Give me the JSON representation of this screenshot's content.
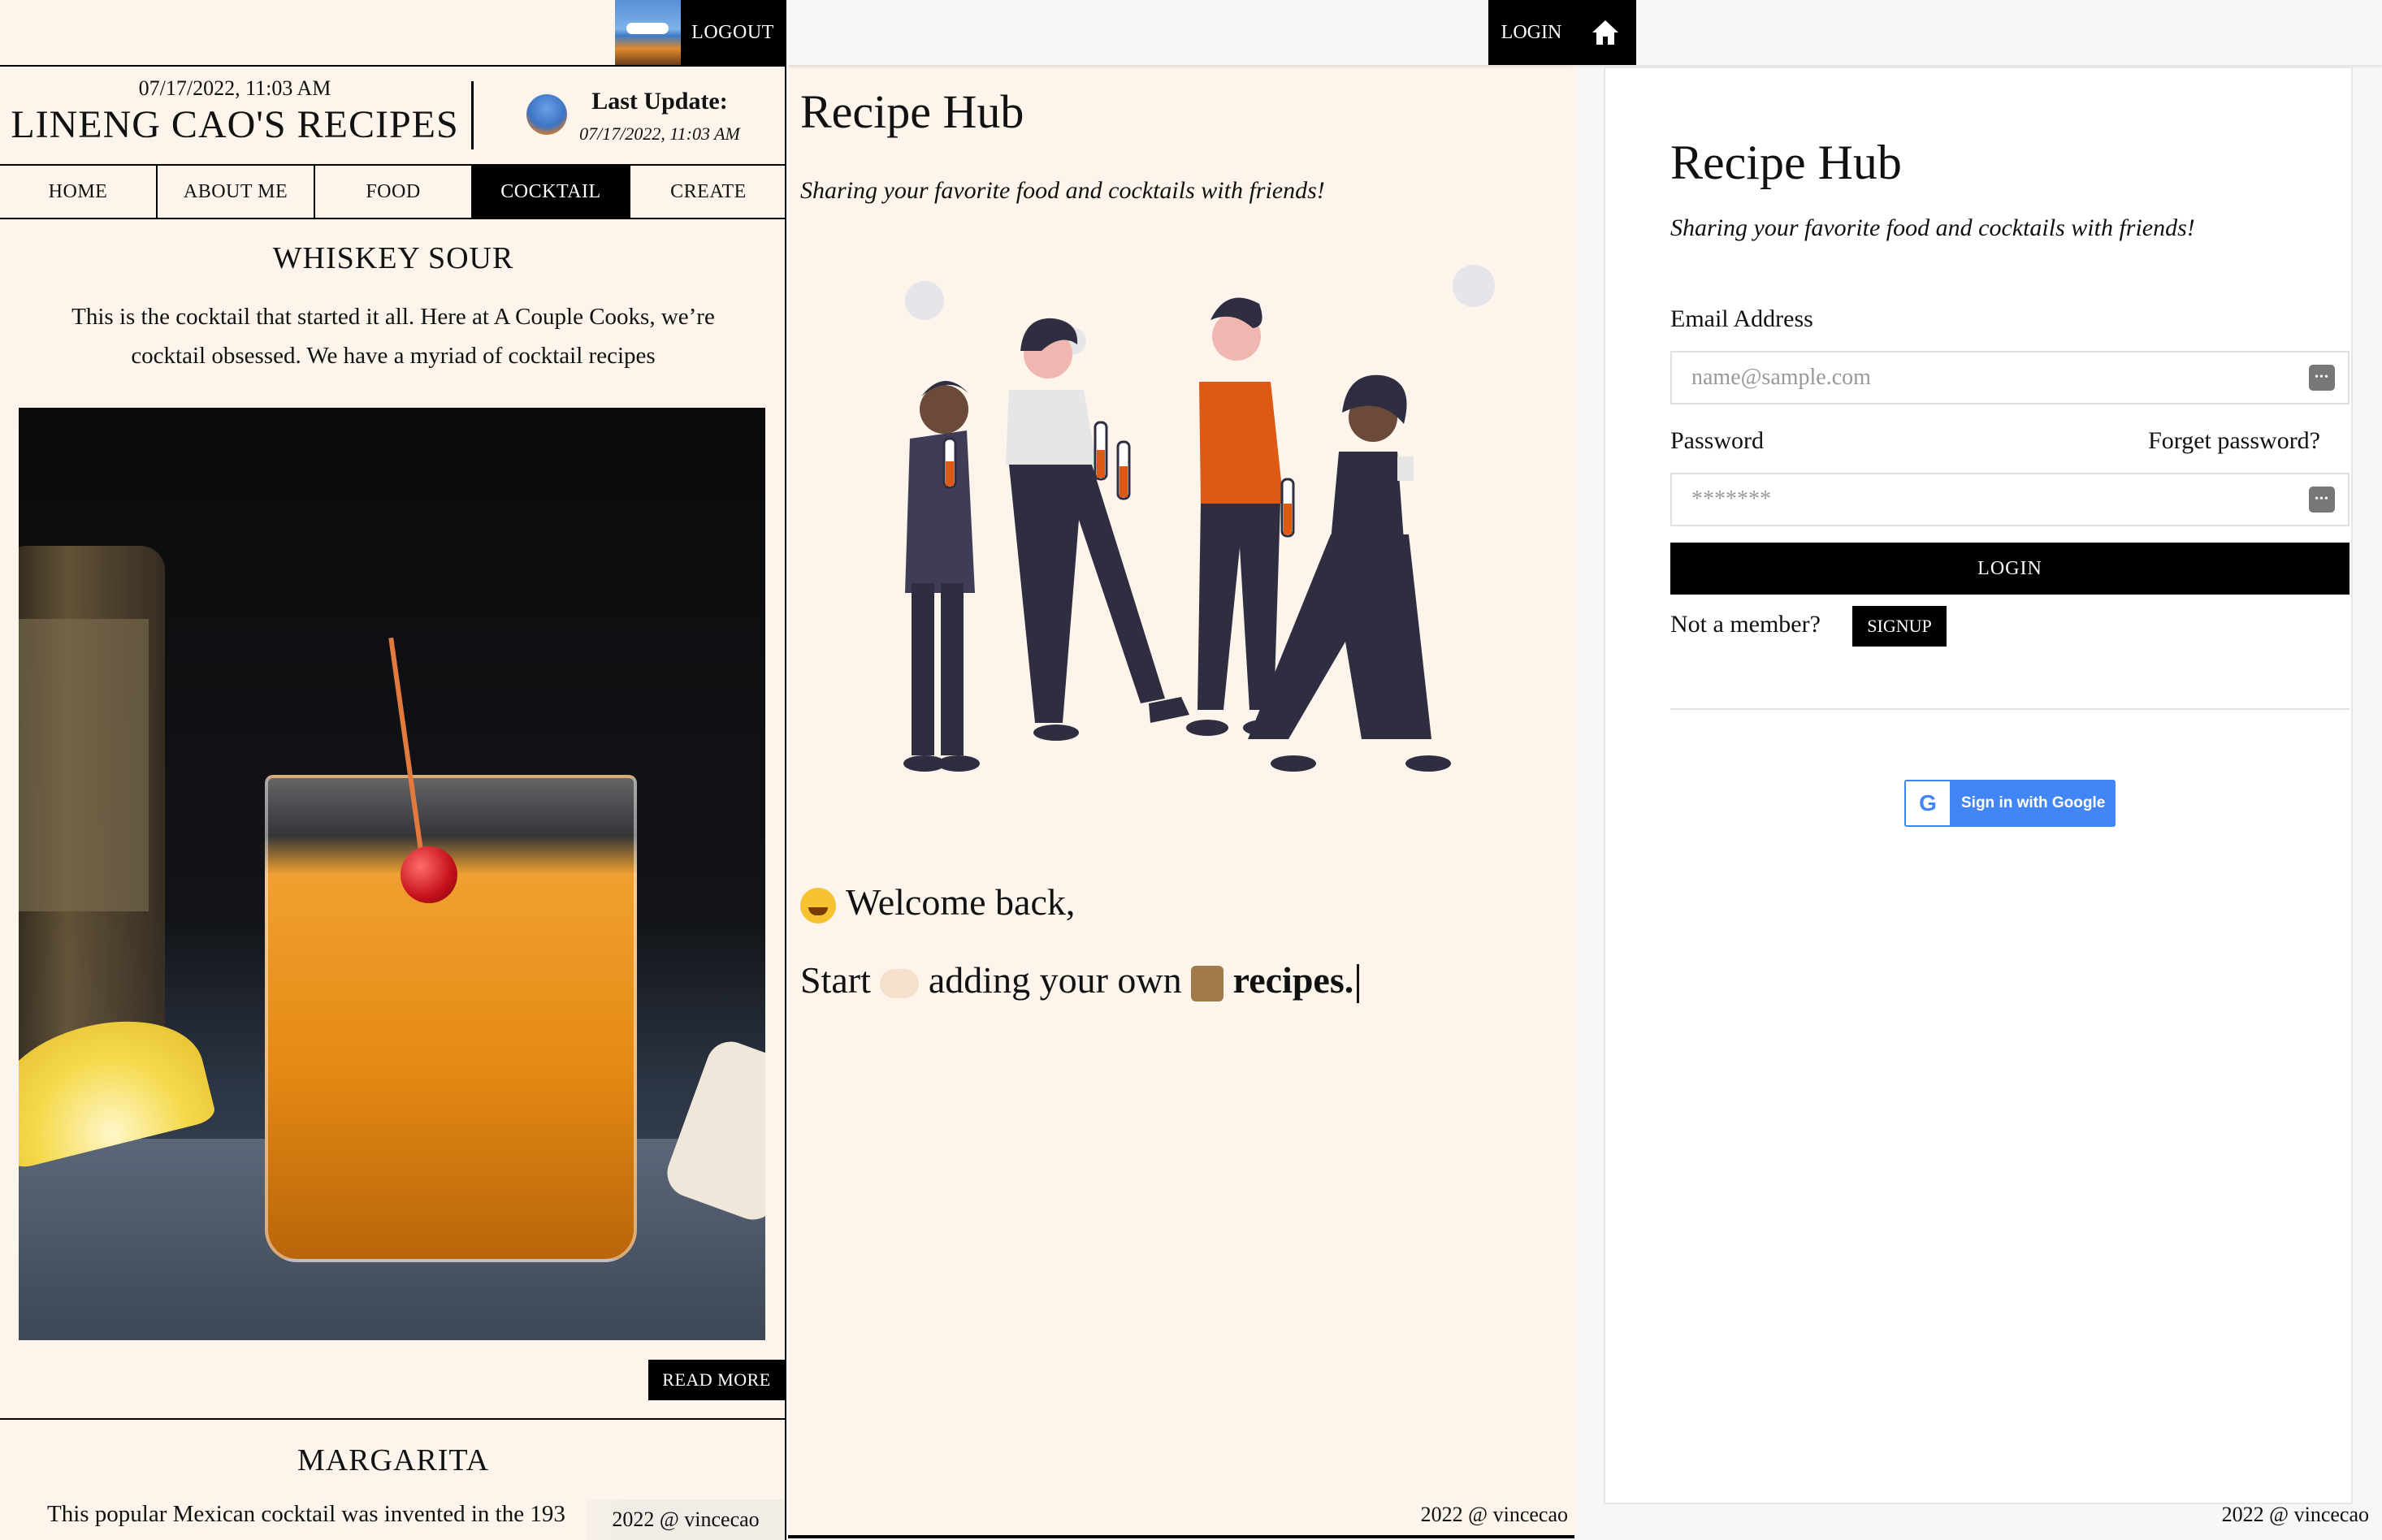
{
  "left": {
    "logout_label": "LOGOUT",
    "date_top": "07/17/2022, 11:03 AM",
    "site_title": "LINENG CAO'S RECIPES",
    "last_update_label": "Last Update:",
    "last_update_date": "07/17/2022, 11:03 AM",
    "nav": [
      "HOME",
      "ABOUT ME",
      "FOOD",
      "COCKTAIL",
      "CREATE"
    ],
    "active_tab": "COCKTAIL",
    "recipe1_title": "WHISKEY SOUR",
    "recipe1_desc": "This is the cocktail that started it all. Here at A Couple Cooks, we’re cocktail obsessed. We have a myriad of cocktail recipes",
    "read_more": "READ MORE",
    "recipe2_title": "MARGARITA",
    "recipe2_desc": "This popular Mexican cocktail was invented in the 193",
    "footer": "2022 @ vincecao"
  },
  "mid": {
    "login_label": "LOGIN",
    "hub_title": "Recipe Hub",
    "hub_tagline": "Sharing your favorite food and cocktails with friends!",
    "welcome": "Welcome back,",
    "start_prefix": "Start",
    "start_middle": "adding your own",
    "start_bold": "recipes.",
    "footer": "2022 @ vincecao"
  },
  "right": {
    "hub_title": "Recipe Hub",
    "hub_tagline": "Sharing your favorite food and cocktails with friends!",
    "email_label": "Email Address",
    "email_placeholder": "name@sample.com",
    "password_label": "Password",
    "forget_password": "Forget password?",
    "password_placeholder": "*******",
    "login_button": "LOGIN",
    "not_member": "Not a member?",
    "signup_button": "SIGNUP",
    "google_button": "Sign in with Google",
    "footer": "2022 @ vincecao"
  },
  "colors": {
    "cream": "#fdf5ec",
    "black": "#000000",
    "orange": "#de5a12",
    "google_blue": "#4285f4"
  }
}
